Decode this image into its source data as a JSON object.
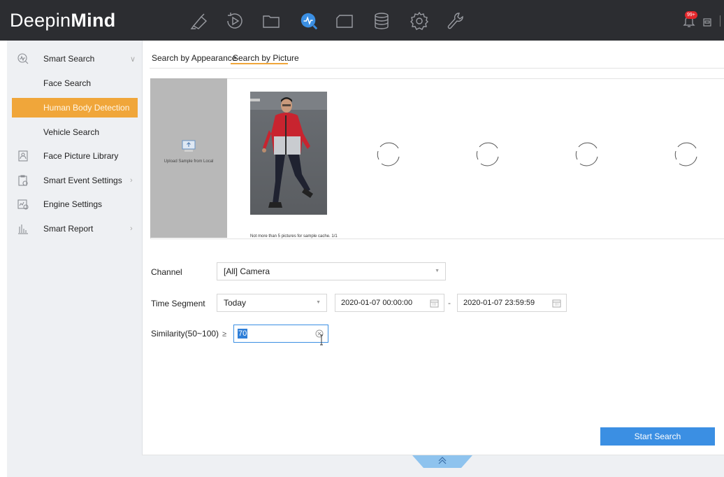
{
  "app": {
    "logo_part1": "Deepin",
    "logo_part2": "Mind"
  },
  "topnav": {
    "icons": [
      "camera-icon",
      "playback-icon",
      "file-folder-icon",
      "smart-analysis-icon",
      "display-icon",
      "storage-icon",
      "settings-gear-icon",
      "maintenance-wrench-icon"
    ],
    "active": "smart-analysis-icon",
    "notification_badge": "99+"
  },
  "sidebar": {
    "items": [
      {
        "label": "Smart Search",
        "icon": "smart-search-icon",
        "chevron": "∨"
      },
      {
        "label": "Face Search"
      },
      {
        "label": "Human Body Detection",
        "active": true
      },
      {
        "label": "Vehicle Search"
      },
      {
        "label": "Face Picture Library",
        "icon": "face-library-icon"
      },
      {
        "label": "Smart Event Settings",
        "icon": "event-settings-icon",
        "chevron": "›"
      },
      {
        "label": "Engine Settings",
        "icon": "engine-settings-icon"
      },
      {
        "label": "Smart Report",
        "icon": "report-chart-icon",
        "chevron": "›"
      }
    ]
  },
  "tabs": {
    "appearance": "Search by Appearance",
    "picture": "Search by Picture",
    "active": "picture"
  },
  "samples": {
    "upload_label": "Upload Sample from Local",
    "cache_note": "Not more than 5 pictures for sample cache. 1/1"
  },
  "form": {
    "channel_label": "Channel",
    "channel_value": "[All] Camera",
    "time_label": "Time Segment",
    "time_value": "Today",
    "start_time": "2020-01-07 00:00:00",
    "end_time": "2020-01-07 23:59:59",
    "similarity_label": "Similarity(50~100)",
    "similarity_op": "≥",
    "similarity_value": "70"
  },
  "actions": {
    "start_search": "Start Search",
    "expand": "«"
  },
  "colors": {
    "accent_orange": "#f0a63a",
    "accent_blue": "#3b8fe3",
    "topbar": "#2c2d31",
    "sidebar_bg": "#eef0f3"
  }
}
